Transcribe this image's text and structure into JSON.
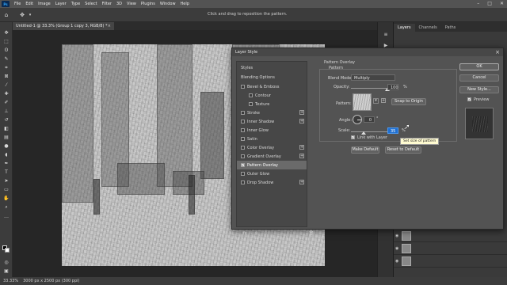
{
  "menubar": {
    "items": [
      "File",
      "Edit",
      "Image",
      "Layer",
      "Type",
      "Select",
      "Filter",
      "3D",
      "View",
      "Plugins",
      "Window",
      "Help"
    ]
  },
  "options": {
    "hint": "Click and drag to reposition the pattern."
  },
  "document": {
    "tab_title": "Untitled-1 @ 33.3% (Group 1 copy 3, RGB/8) *"
  },
  "status": {
    "zoom": "33.33%",
    "info": "3000 px x 2500 px (300 ppi)"
  },
  "panels": {
    "tabs": [
      "Layers",
      "Channels",
      "Paths"
    ]
  },
  "dialog": {
    "title": "Layer Style",
    "styles_header": "Styles",
    "blending_options": "Blending Options",
    "items": [
      {
        "label": "Bevel & Emboss",
        "checked": false,
        "sub": false,
        "plus": false
      },
      {
        "label": "Contour",
        "checked": false,
        "sub": true,
        "plus": false
      },
      {
        "label": "Texture",
        "checked": false,
        "sub": true,
        "plus": false
      },
      {
        "label": "Stroke",
        "checked": false,
        "sub": false,
        "plus": true
      },
      {
        "label": "Inner Shadow",
        "checked": false,
        "sub": false,
        "plus": true
      },
      {
        "label": "Inner Glow",
        "checked": false,
        "sub": false,
        "plus": false
      },
      {
        "label": "Satin",
        "checked": false,
        "sub": false,
        "plus": false
      },
      {
        "label": "Color Overlay",
        "checked": false,
        "sub": false,
        "plus": true
      },
      {
        "label": "Gradient Overlay",
        "checked": false,
        "sub": false,
        "plus": true
      },
      {
        "label": "Pattern Overlay",
        "checked": true,
        "sub": false,
        "plus": false
      },
      {
        "label": "Outer Glow",
        "checked": false,
        "sub": false,
        "plus": false
      },
      {
        "label": "Drop Shadow",
        "checked": false,
        "sub": false,
        "plus": true
      }
    ],
    "fx_label": "fx.",
    "section_title": "Pattern Overlay",
    "group_title": "Pattern",
    "blend_mode_label": "Blend Mode:",
    "blend_mode_value": "Multiply",
    "opacity_label": "Opacity:",
    "opacity_value": "100",
    "percent": "%",
    "pattern_label": "Pattern:",
    "snap_button": "Snap to Origin",
    "angle_label": "Angle:",
    "angle_value": "0",
    "scale_label": "Scale:",
    "scale_value": "35",
    "link_label": "Link with Layer",
    "tooltip": "Set size of pattern",
    "make_default": "Make Default",
    "reset_default": "Reset to Default",
    "ok": "OK",
    "cancel": "Cancel",
    "new_style": "New Style...",
    "preview": "Preview"
  },
  "levels": {
    "opacity_fraction": 1.0,
    "scale_fraction": 0.35
  }
}
